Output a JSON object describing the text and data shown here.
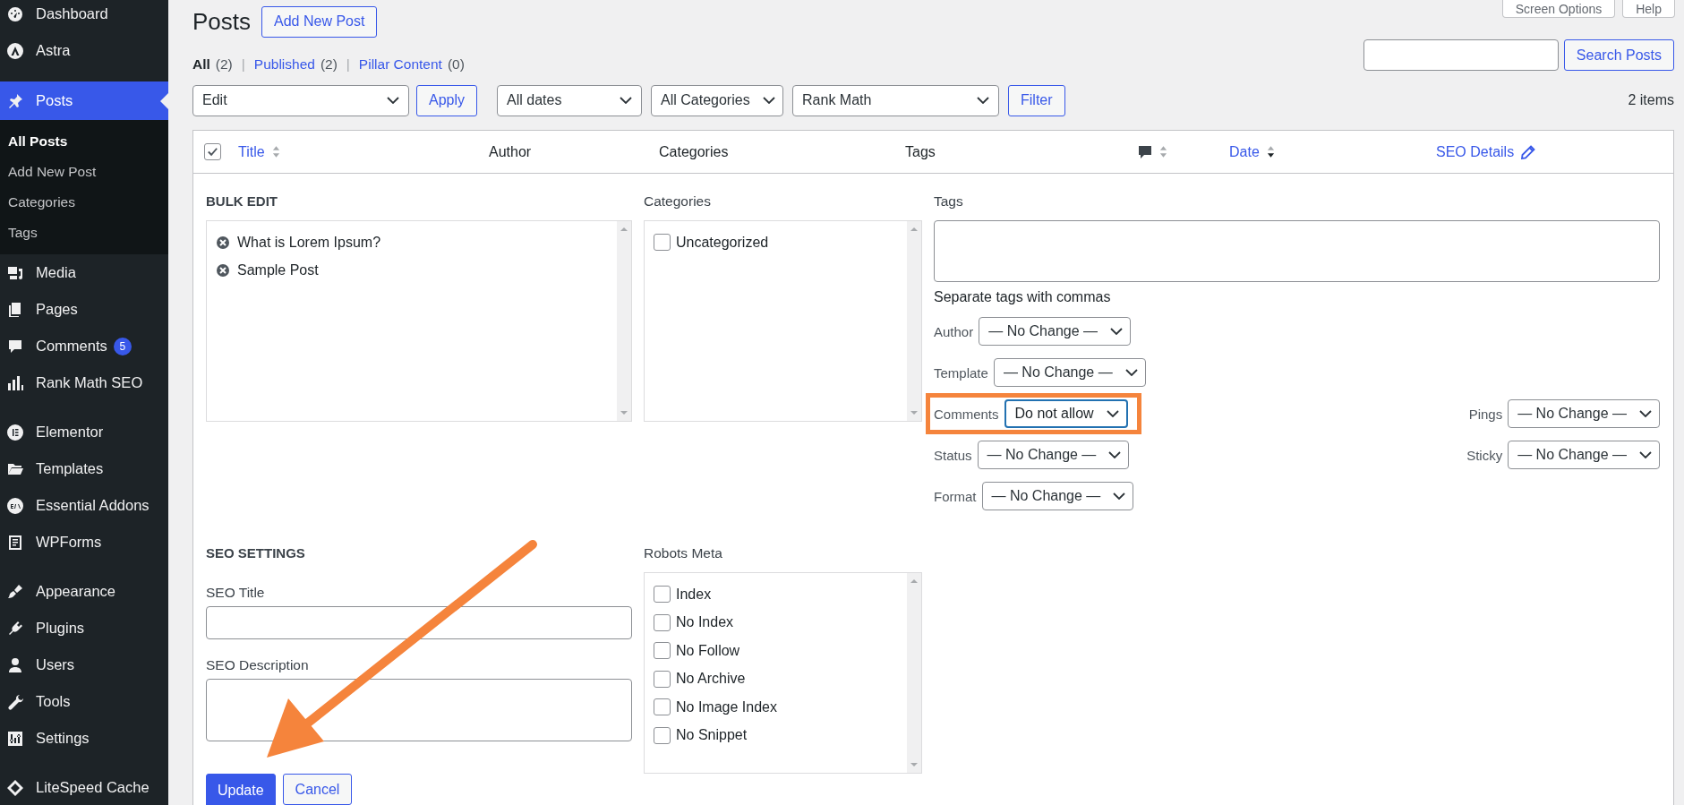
{
  "sidebar": {
    "groups": [
      {
        "items": [
          {
            "label": "Dashboard",
            "selected": false
          },
          {
            "label": "Astra",
            "selected": false
          }
        ]
      },
      {
        "items": [
          {
            "label": "Posts",
            "selected": true,
            "children": [
              {
                "label": "All Posts",
                "selected": true
              },
              {
                "label": "Add New Post",
                "selected": false
              },
              {
                "label": "Categories",
                "selected": false
              },
              {
                "label": "Tags",
                "selected": false
              }
            ]
          },
          {
            "label": "Media",
            "selected": false
          },
          {
            "label": "Pages",
            "selected": false
          },
          {
            "label": "Comments",
            "selected": false,
            "badge": "5"
          },
          {
            "label": "Rank Math SEO",
            "selected": false
          }
        ]
      },
      {
        "items": [
          {
            "label": "Elementor",
            "selected": false
          },
          {
            "label": "Templates",
            "selected": false
          },
          {
            "label": "Essential Addons",
            "selected": false
          },
          {
            "label": "WPForms",
            "selected": false
          }
        ]
      },
      {
        "items": [
          {
            "label": "Appearance",
            "selected": false
          },
          {
            "label": "Plugins",
            "selected": false
          },
          {
            "label": "Users",
            "selected": false
          },
          {
            "label": "Tools",
            "selected": false
          },
          {
            "label": "Settings",
            "selected": false
          }
        ]
      },
      {
        "items": [
          {
            "label": "LiteSpeed Cache",
            "selected": false
          }
        ]
      }
    ]
  },
  "header": {
    "title": "Posts",
    "add_button": "Add New Post",
    "screen_options": "Screen Options",
    "help": "Help"
  },
  "views": [
    {
      "label": "All",
      "count": "(2)",
      "selected": true
    },
    {
      "separator": "|",
      "label": "Published",
      "count": "(2)",
      "selected": false
    },
    {
      "separator": "|",
      "label": "Pillar Content",
      "count": "(0)",
      "selected": false
    }
  ],
  "search": {
    "button": "Search Posts"
  },
  "bulk_actions": {
    "value": "Edit",
    "button": "Apply"
  },
  "filters": [
    {
      "value": "All dates"
    },
    {
      "value": "All Categories"
    },
    {
      "value": "Rank Math"
    }
  ],
  "filter_button": "Filter",
  "item_count": "2 items",
  "table": {
    "select_all_checked": true,
    "columns": [
      {
        "label": "Title",
        "kind": "sortable"
      },
      {
        "label": "Author",
        "kind": "plain"
      },
      {
        "label": "Categories",
        "kind": "plain"
      },
      {
        "label": "Tags",
        "kind": "plain"
      },
      {
        "kind": "comments"
      },
      {
        "label": "Date",
        "kind": "sorted"
      },
      {
        "label": "SEO Details",
        "kind": "editable"
      }
    ]
  },
  "bulk_edit": {
    "title": "BULK EDIT",
    "posts": [
      "What is Lorem Ipsum?",
      "Sample Post"
    ],
    "categories_label": "Categories",
    "categories": [
      {
        "label": "Uncategorized",
        "checked": false
      }
    ],
    "tags_label": "Tags",
    "tags_hint": "Separate tags with commas",
    "rows": [
      {
        "fields": [
          {
            "label": "Author",
            "value": "— No Change —",
            "focused": false,
            "highlighted": false
          }
        ]
      },
      {
        "fields": [
          {
            "label": "Template",
            "value": "— No Change —",
            "focused": false,
            "highlighted": false
          }
        ]
      },
      {
        "fields": [
          {
            "label": "Comments",
            "value": "Do not allow",
            "focused": true,
            "highlighted": true
          },
          {
            "label": "Pings",
            "value": "— No Change —",
            "focused": false,
            "highlighted": false
          }
        ]
      },
      {
        "fields": [
          {
            "label": "Status",
            "value": "— No Change —",
            "focused": false,
            "highlighted": false
          },
          {
            "label": "Sticky",
            "value": "— No Change —",
            "focused": false,
            "highlighted": false
          }
        ]
      },
      {
        "fields": [
          {
            "label": "Format",
            "value": "— No Change —",
            "focused": false,
            "highlighted": false
          }
        ]
      }
    ],
    "seo": {
      "title": "SEO SETTINGS",
      "title_label": "SEO Title",
      "description_label": "SEO Description"
    },
    "robots_label": "Robots Meta",
    "robots": [
      {
        "label": "Index",
        "checked": false
      },
      {
        "label": "No Index",
        "checked": false
      },
      {
        "label": "No Follow",
        "checked": false
      },
      {
        "label": "No Archive",
        "checked": false
      },
      {
        "label": "No Image Index",
        "checked": false
      },
      {
        "label": "No Snippet",
        "checked": false
      }
    ],
    "update_button": "Update",
    "cancel_button": "Cancel"
  }
}
